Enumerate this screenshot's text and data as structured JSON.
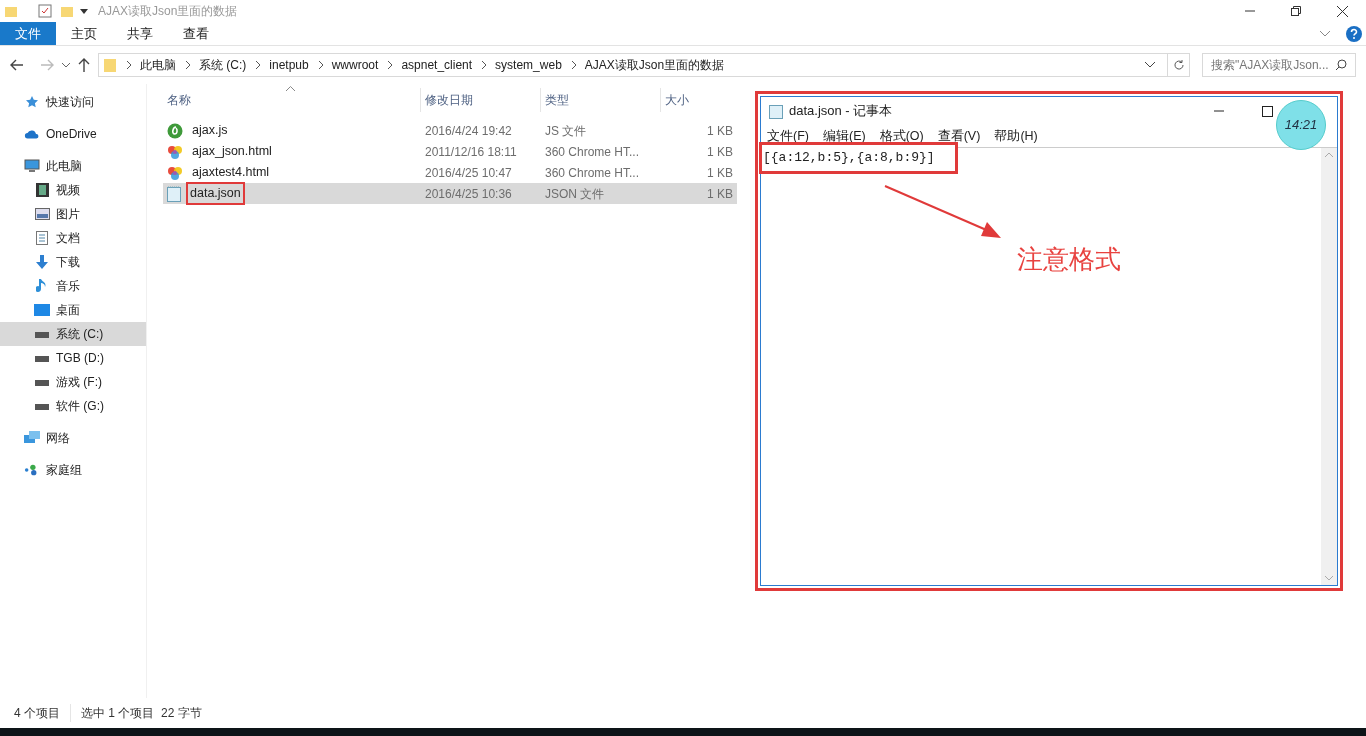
{
  "window": {
    "title": "AJAX读取Json里面的数据"
  },
  "ribbon_tabs": [
    {
      "label": "文件",
      "selected": true
    },
    {
      "label": "主页",
      "selected": false
    },
    {
      "label": "共享",
      "selected": false
    },
    {
      "label": "查看",
      "selected": false
    }
  ],
  "breadcrumb": [
    "此电脑",
    "系统 (C:)",
    "inetpub",
    "wwwroot",
    "aspnet_client",
    "system_web",
    "AJAX读取Json里面的数据"
  ],
  "search": {
    "placeholder": "搜索\"AJAX读取Json..."
  },
  "sidebar": {
    "items": [
      {
        "label": "快速访问",
        "kind": "star",
        "selected": false
      },
      {
        "label": "OneDrive",
        "kind": "cloud",
        "selected": false
      },
      {
        "label": "此电脑",
        "kind": "pc",
        "selected": false,
        "children": [
          {
            "label": "视频",
            "kind": "video",
            "selected": false
          },
          {
            "label": "图片",
            "kind": "picture",
            "selected": false
          },
          {
            "label": "文档",
            "kind": "document",
            "selected": false
          },
          {
            "label": "下载",
            "kind": "download",
            "selected": false
          },
          {
            "label": "音乐",
            "kind": "music",
            "selected": false
          },
          {
            "label": "桌面",
            "kind": "desktop",
            "selected": false
          },
          {
            "label": "系统 (C:)",
            "kind": "drive",
            "selected": true
          },
          {
            "label": "TGB (D:)",
            "kind": "drive",
            "selected": false
          },
          {
            "label": "游戏 (F:)",
            "kind": "drive",
            "selected": false
          },
          {
            "label": "软件 (G:)",
            "kind": "drive",
            "selected": false
          }
        ]
      },
      {
        "label": "网络",
        "kind": "network",
        "selected": false
      },
      {
        "label": "家庭组",
        "kind": "homegroup",
        "selected": false
      }
    ]
  },
  "table": {
    "columns": [
      "名称",
      "修改日期",
      "类型",
      "大小"
    ],
    "rows": [
      {
        "name": "ajax.js",
        "date": "2016/4/24 19:42",
        "type": "JS 文件",
        "size": "1 KB",
        "kind": "script",
        "selected": false,
        "highlighted": false
      },
      {
        "name": "ajax_json.html",
        "date": "2011/12/16 18:11",
        "type": "360 Chrome HT...",
        "size": "1 KB",
        "kind": "html",
        "selected": false,
        "highlighted": false
      },
      {
        "name": "ajaxtest4.html",
        "date": "2016/4/25 10:47",
        "type": "360 Chrome HT...",
        "size": "1 KB",
        "kind": "html",
        "selected": false,
        "highlighted": false
      },
      {
        "name": "data.json",
        "date": "2016/4/25 10:36",
        "type": "JSON 文件",
        "size": "1 KB",
        "kind": "text",
        "selected": true,
        "highlighted": true
      }
    ]
  },
  "status_bar": [
    "4 个项目",
    "选中 1 个项目  22 字节"
  ],
  "notepad": {
    "title": "data.json - 记事本",
    "menu": [
      "文件(F)",
      "编辑(E)",
      "格式(O)",
      "查看(V)",
      "帮助(H)"
    ],
    "content": "[{a:12,b:5},{a:8,b:9}]"
  },
  "annotation": {
    "text": "注意格式"
  },
  "clock_widget": {
    "time": "14:21"
  }
}
